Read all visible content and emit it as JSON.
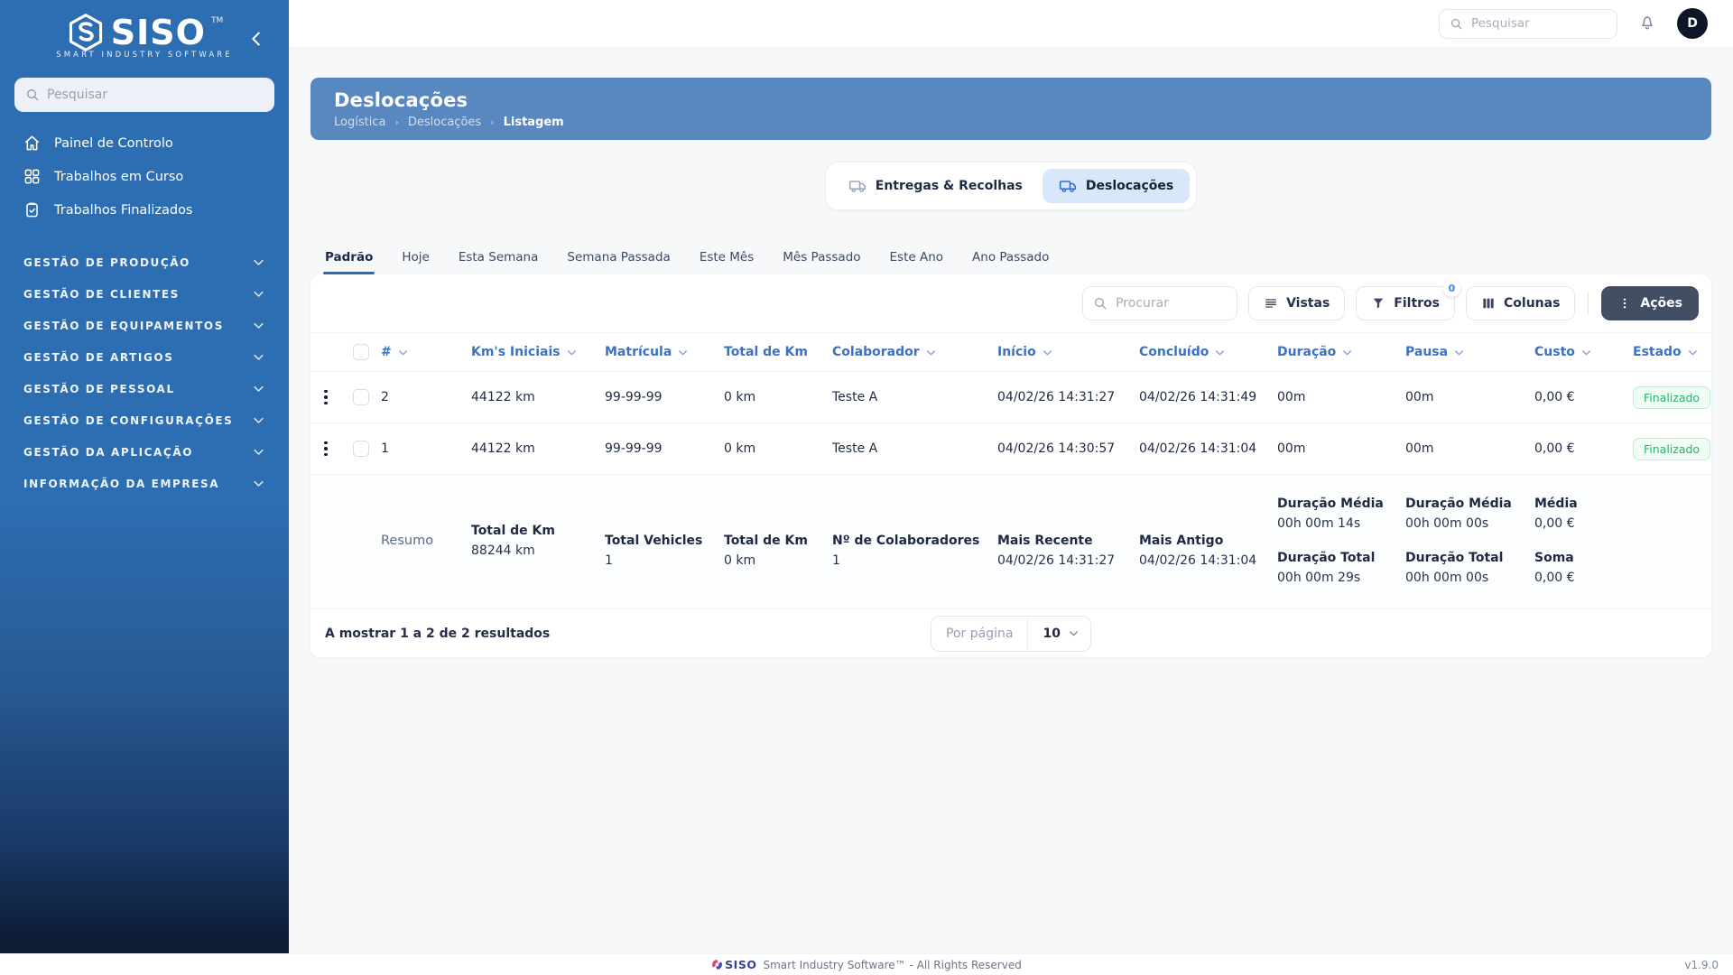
{
  "colors": {
    "sidebar_blue": "#2d6eb3",
    "sidebar_bottom": "#0d1b33",
    "banner_blue": "#5987c0",
    "accent_blue": "#3b72c4",
    "active_toggle_bg": "#d9e7fa",
    "dark_button": "#414e63",
    "badge_green_text": "#27b36a",
    "badge_green_bg": "#effdf4"
  },
  "sidebar": {
    "logo_title": "SISO",
    "logo_tm": "TM",
    "logo_subtitle": "SMART INDUSTRY SOFTWARE",
    "search_placeholder": "Pesquisar",
    "items": [
      {
        "label": "Painel de Controlo",
        "icon": "home-icon"
      },
      {
        "label": "Trabalhos em Curso",
        "icon": "grid-icon"
      },
      {
        "label": "Trabalhos Finalizados",
        "icon": "clipboard-icon"
      }
    ],
    "sections": [
      "GESTÃO DE PRODUÇÃO",
      "GESTÃO DE CLIENTES",
      "GESTÃO DE EQUIPAMENTOS",
      "GESTÃO DE ARTIGOS",
      "GESTÃO DE PESSOAL",
      "GESTÃO DE CONFIGURAÇÕES",
      "GESTÃO DA APLICAÇÃO",
      "INFORMAÇÃO DA EMPRESA"
    ]
  },
  "topbar": {
    "search_placeholder": "Pesquisar",
    "avatar_initial": "D"
  },
  "header": {
    "title": "Deslocações",
    "breadcrumb": [
      "Logística",
      "Deslocações",
      "Listagem"
    ]
  },
  "view_toggle": {
    "options": [
      {
        "label": "Entregas & Recolhas",
        "active": false
      },
      {
        "label": "Deslocações",
        "active": true
      }
    ]
  },
  "tabs": [
    "Padrão",
    "Hoje",
    "Esta Semana",
    "Semana Passada",
    "Este Mês",
    "Mês Passado",
    "Este Ano",
    "Ano Passado"
  ],
  "toolbar": {
    "search_placeholder": "Procurar",
    "vistas_label": "Vistas",
    "filtros_label": "Filtros",
    "filtros_badge": "0",
    "colunas_label": "Colunas",
    "acoes_label": "Ações"
  },
  "table": {
    "columns": [
      "#",
      "Km's Iniciais",
      "Matrícula",
      "Total de Km",
      "Colaborador",
      "Início",
      "Concluído",
      "Duração",
      "Pausa",
      "Custo",
      "Estado"
    ],
    "rows": [
      {
        "num": "2",
        "kms_iniciais": "44122 km",
        "matricula": "99-99-99",
        "total_km": "0 km",
        "colaborador": "Teste A",
        "inicio": "04/02/26 14:31:27",
        "concluido": "04/02/26 14:31:49",
        "duracao": "00m",
        "pausa": "00m",
        "custo": "0,00 €",
        "estado": "Finalizado"
      },
      {
        "num": "1",
        "kms_iniciais": "44122 km",
        "matricula": "99-99-99",
        "total_km": "0 km",
        "colaborador": "Teste A",
        "inicio": "04/02/26 14:30:57",
        "concluido": "04/02/26 14:31:04",
        "duracao": "00m",
        "pausa": "00m",
        "custo": "0,00 €",
        "estado": "Finalizado"
      }
    ],
    "summary": {
      "label": "Resumo",
      "kms_iniciais": {
        "label": "Total de Km",
        "value": "88244 km"
      },
      "matricula": {
        "label": "Total Vehicles",
        "value": "1"
      },
      "total_km": {
        "label": "Total de Km",
        "value": "0 km"
      },
      "colaborador": {
        "label": "Nº de Colaboradores",
        "value": "1"
      },
      "inicio": {
        "label": "Mais Recente",
        "value": "04/02/26 14:31:27"
      },
      "concluido": {
        "label": "Mais Antigo",
        "value": "04/02/26 14:31:04"
      },
      "duracao": [
        {
          "label": "Duração Média",
          "value": "00h 00m 14s"
        },
        {
          "label": "Duração Total",
          "value": "00h 00m 29s"
        }
      ],
      "pausa": [
        {
          "label": "Duração Média",
          "value": "00h 00m 00s"
        },
        {
          "label": "Duração Total",
          "value": "00h 00m 00s"
        }
      ],
      "custo": [
        {
          "label": "Média",
          "value": "0,00 €"
        },
        {
          "label": "Soma",
          "value": "0,00 €"
        }
      ]
    }
  },
  "pagination": {
    "results_text": "A mostrar 1 a 2 de 2 resultados",
    "per_page_label": "Por página",
    "per_page_value": "10"
  },
  "footer": {
    "brand": "SISO",
    "text": "Smart Industry Software™ - All Rights Reserved",
    "version": "v1.9.0"
  }
}
